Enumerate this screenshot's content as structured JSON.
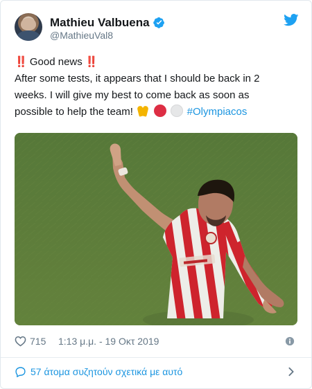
{
  "tweet": {
    "author": {
      "display_name": "Mathieu Valbuena",
      "handle": "@MathieuVal8",
      "avatar_icon": "avatar-photo",
      "verified_icon": "verified-badge-icon"
    },
    "brand_icon": "twitter-bird-icon",
    "text": {
      "line1_text": "Good news",
      "line2": "After some tests, it appears that I should be back in 2",
      "line3": "weeks. I will give my best to come back as soon as",
      "line4_text": "possible to help the team!",
      "hashtag": "#Olympiacos",
      "exclamation": "‼️",
      "emoji_names": [
        "double-exclamation-icon",
        "folded-hands-icon",
        "red-circle-icon",
        "white-circle-icon"
      ]
    },
    "media": {
      "description_icon": "football-player-photo"
    },
    "footer": {
      "likes": "715",
      "time": "1:13 μ.μ. - 19 Οκτ 2019",
      "icons": [
        "heart-icon",
        "info-icon"
      ]
    },
    "discussion": {
      "label": "57 άτομα συζητούν σχετικά με αυτό",
      "icons": [
        "chat-bubble-icon",
        "chevron-right-icon"
      ]
    }
  },
  "colors": {
    "text": "#14171a",
    "secondary_text": "#657786",
    "link": "#1b95e0",
    "verified": "#1da1f2",
    "emoji_red": "#dd2e44",
    "pitch_green": "#5f7f3f",
    "kit_red": "#d7262f"
  }
}
